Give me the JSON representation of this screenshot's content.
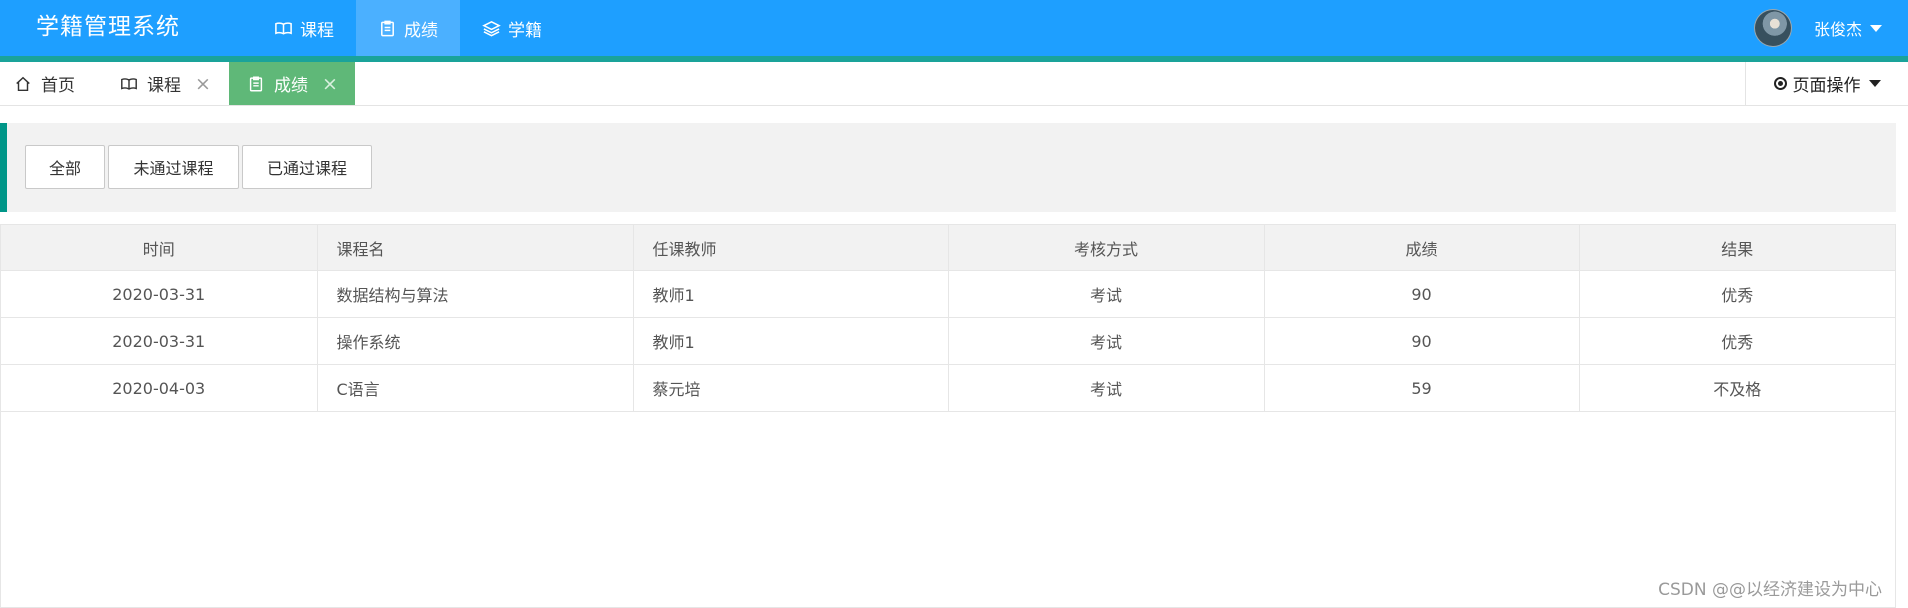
{
  "header": {
    "title": "学籍管理系统",
    "nav": [
      {
        "label": "课程",
        "icon": "book-icon",
        "active": false
      },
      {
        "label": "成绩",
        "icon": "clipboard-icon",
        "active": true
      },
      {
        "label": "学籍",
        "icon": "layers-icon",
        "active": false
      }
    ],
    "user_name": "张俊杰"
  },
  "tabs": [
    {
      "label": "首页",
      "icon": "home-icon",
      "closable": false
    },
    {
      "label": "课程",
      "icon": "book-icon",
      "closable": true
    },
    {
      "label": "成绩",
      "icon": "clipboard-icon",
      "closable": true,
      "active": true
    }
  ],
  "page_ops": {
    "label": "页面操作"
  },
  "filters": [
    {
      "label": "全部"
    },
    {
      "label": "未通过课程"
    },
    {
      "label": "已通过课程"
    }
  ],
  "table": {
    "columns": [
      "时间",
      "课程名",
      "任课教师",
      "考核方式",
      "成绩",
      "结果"
    ],
    "rows": [
      {
        "time": "2020-03-31",
        "course": "数据结构与算法",
        "teacher": "教师1",
        "exam": "考试",
        "score": "90",
        "result": "优秀"
      },
      {
        "time": "2020-03-31",
        "course": "操作系统",
        "teacher": "教师1",
        "exam": "考试",
        "score": "90",
        "result": "优秀"
      },
      {
        "time": "2020-04-03",
        "course": "C语言",
        "teacher": "蔡元培",
        "exam": "考试",
        "score": "59",
        "result": "不及格"
      }
    ]
  },
  "watermark": "CSDN @@以经济建设为中心",
  "colors": {
    "header": "#1e9fff",
    "header_active": "#4bb0ff",
    "header_strip": "#1aa39a",
    "active_tab": "#5fb878",
    "filter_accent": "#009688"
  }
}
